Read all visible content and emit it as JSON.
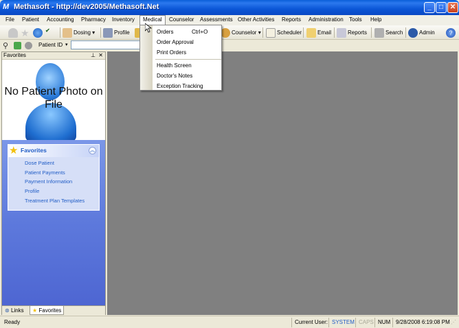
{
  "window": {
    "title": "Methasoft - http://dev2005/Methasoft.Net",
    "app_icon": "M",
    "controls": [
      "minimize",
      "maximize",
      "close"
    ]
  },
  "menubar": {
    "items": [
      "File",
      "Patient",
      "Accounting",
      "Pharmacy",
      "Inventory",
      "Medical",
      "Counselor",
      "Assessments",
      "Other Activities",
      "Reports",
      "Administration",
      "Tools",
      "Help"
    ],
    "active": "Medical"
  },
  "toolbar": {
    "dosing": "Dosing",
    "profile": "Profile",
    "counselor": "Counselor",
    "scheduler": "Scheduler",
    "email": "Email",
    "reports": "Reports",
    "search": "Search",
    "admin": "Admin"
  },
  "toolbar2": {
    "patient_id_label": "Patient ID",
    "patient_id_value": ""
  },
  "left_pane": {
    "header": "Favorites",
    "photo_text": "No Patient Photo on File",
    "favorites_title": "Favorites",
    "links": [
      "Dose Patient",
      "Patient Payments",
      "Payment Information",
      "Profile",
      "Treatment Plan Templates"
    ],
    "tabs": [
      "Links",
      "Favorites"
    ],
    "active_tab": "Favorites"
  },
  "dropdown": {
    "items": [
      {
        "label": "Orders",
        "shortcut": "Ctrl+O"
      },
      {
        "label": "Order Approval",
        "shortcut": ""
      },
      {
        "label": "Print Orders",
        "shortcut": ""
      },
      {
        "label": "Health Screen",
        "shortcut": ""
      },
      {
        "label": "Doctor's Notes",
        "shortcut": ""
      },
      {
        "label": "Exception Tracking",
        "shortcut": ""
      }
    ]
  },
  "statusbar": {
    "status": "Ready",
    "current_user_label": "Current User:",
    "current_user": "SYSTEM",
    "caps": "CAPS",
    "num": "NUM",
    "datetime": "9/28/2008 6:19:08 PM"
  },
  "colors": {
    "title_bar": "#0b56d6",
    "workspace": "#808080",
    "link": "#215dc6",
    "user": "#215dc6"
  }
}
